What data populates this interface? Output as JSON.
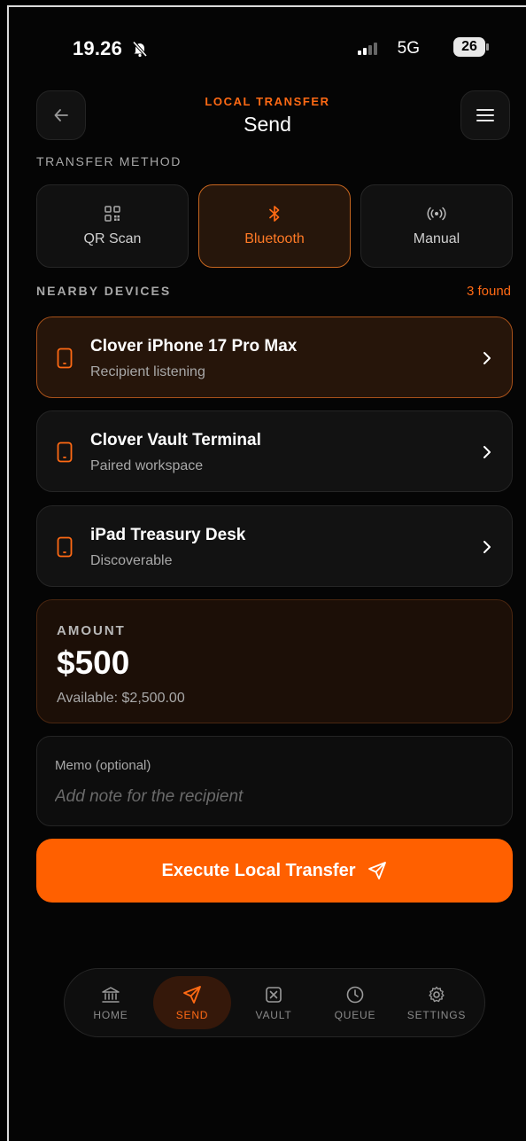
{
  "status": {
    "time": "19.26",
    "network": "5G",
    "battery": "26"
  },
  "header": {
    "eyebrow": "LOCAL TRANSFER",
    "title": "Send"
  },
  "transfer_method": {
    "label": "TRANSFER METHOD",
    "options": [
      {
        "label": "QR Scan",
        "icon": "qr-code-icon"
      },
      {
        "label": "Bluetooth",
        "icon": "bluetooth-icon",
        "selected": true
      },
      {
        "label": "Manual",
        "icon": "broadcast-icon"
      }
    ]
  },
  "nearby": {
    "label": "NEARBY DEVICES",
    "count": "3 found",
    "devices": [
      {
        "name": "Clover iPhone 17 Pro Max",
        "status": "Recipient listening",
        "selected": true
      },
      {
        "name": "Clover Vault Terminal",
        "status": "Paired workspace"
      },
      {
        "name": "iPad Treasury Desk",
        "status": "Discoverable"
      }
    ]
  },
  "amount": {
    "label": "AMOUNT",
    "value": "$500",
    "available": "Available: $2,500.00"
  },
  "memo": {
    "label": "Memo (optional)",
    "placeholder": "Add note for the recipient"
  },
  "cta": {
    "label": "Execute Local Transfer"
  },
  "nav": [
    {
      "label": "HOME",
      "icon": "bank-icon"
    },
    {
      "label": "SEND",
      "icon": "send-icon",
      "active": true
    },
    {
      "label": "VAULT",
      "icon": "vault-icon"
    },
    {
      "label": "QUEUE",
      "icon": "clock-icon"
    },
    {
      "label": "SETTINGS",
      "icon": "gear-icon"
    }
  ],
  "colors": {
    "accent": "#ff6000",
    "accent_text": "#ff6a14",
    "background": "#050505"
  }
}
